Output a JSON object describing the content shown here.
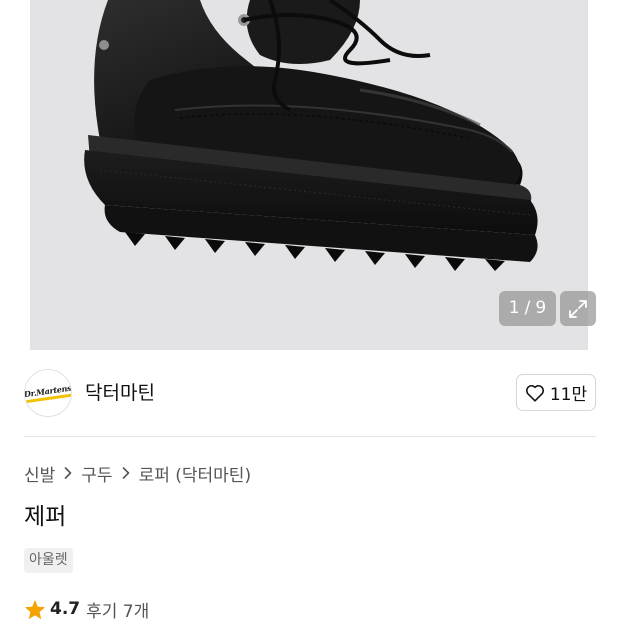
{
  "gallery": {
    "current_index": "1",
    "total": "9",
    "separator": "/",
    "expand_icon": "expand-arrows-icon",
    "image_subject": "shoe-photo"
  },
  "brand": {
    "name": "닥터마틴",
    "logo_icon": "brand-logo",
    "like_icon": "heart-outline-icon",
    "like_count": "11만"
  },
  "breadcrumb": {
    "items": [
      "신발",
      "구두",
      "로퍼 (닥터마틴)"
    ],
    "separator_icon": "chevron-right-icon"
  },
  "product": {
    "title": "제퍼",
    "tag": "아울렛"
  },
  "rating": {
    "star_icon": "star-icon",
    "star_color": "#f5a300",
    "value": "4.7",
    "review_label": "후기 7개"
  }
}
